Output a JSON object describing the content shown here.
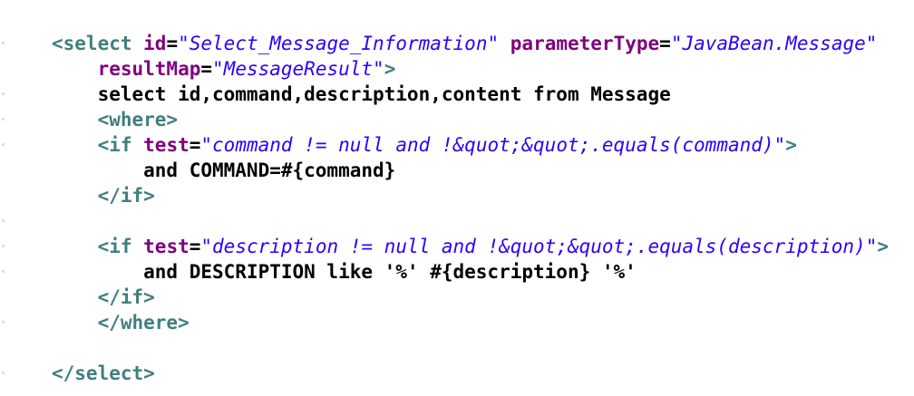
{
  "editor": {
    "colors": {
      "background": "#ffffff",
      "tag": "#3f7f7f",
      "attribute": "#7f007f",
      "value": "#2a00ff",
      "text": "#000000"
    },
    "lines": [
      [
        {
          "kind": "tag",
          "text": "<select "
        },
        {
          "kind": "attr",
          "text": "id"
        },
        {
          "kind": "txt",
          "text": "="
        },
        {
          "kind": "val",
          "text": "\"Select_Message_Information\""
        },
        {
          "kind": "txt",
          "text": " "
        },
        {
          "kind": "attr",
          "text": "parameterType"
        },
        {
          "kind": "txt",
          "text": "="
        },
        {
          "kind": "val",
          "text": "\"JavaBean.Message\""
        }
      ],
      [
        {
          "kind": "txt",
          "text": "    "
        },
        {
          "kind": "attr",
          "text": "resultMap"
        },
        {
          "kind": "txt",
          "text": "="
        },
        {
          "kind": "val",
          "text": "\"MessageResult\""
        },
        {
          "kind": "tag",
          "text": ">"
        }
      ],
      [
        {
          "kind": "txt",
          "text": "    select id,command,description,content from Message"
        }
      ],
      [
        {
          "kind": "txt",
          "text": "    "
        },
        {
          "kind": "tag",
          "text": "<where>"
        }
      ],
      [
        {
          "kind": "txt",
          "text": "    "
        },
        {
          "kind": "tag",
          "text": "<if "
        },
        {
          "kind": "attr",
          "text": "test"
        },
        {
          "kind": "txt",
          "text": "="
        },
        {
          "kind": "val",
          "text": "\"command != null and !&quot;&quot;.equals(command)\""
        },
        {
          "kind": "tag",
          "text": ">"
        }
      ],
      [
        {
          "kind": "txt",
          "text": "        and COMMAND=#{command}"
        }
      ],
      [
        {
          "kind": "txt",
          "text": "    "
        },
        {
          "kind": "tag",
          "text": "</if>"
        }
      ],
      [
        {
          "kind": "txt",
          "text": ""
        }
      ],
      [
        {
          "kind": "txt",
          "text": "    "
        },
        {
          "kind": "tag",
          "text": "<if "
        },
        {
          "kind": "attr",
          "text": "test"
        },
        {
          "kind": "txt",
          "text": "="
        },
        {
          "kind": "val",
          "text": "\"description != null and !&quot;&quot;.equals(description)\""
        },
        {
          "kind": "tag",
          "text": ">"
        }
      ],
      [
        {
          "kind": "txt",
          "text": "        and DESCRIPTION like '%' #{description} '%'"
        }
      ],
      [
        {
          "kind": "txt",
          "text": "    "
        },
        {
          "kind": "tag",
          "text": "</if>"
        }
      ],
      [
        {
          "kind": "txt",
          "text": "    "
        },
        {
          "kind": "tag",
          "text": "</where>"
        }
      ],
      [
        {
          "kind": "txt",
          "text": ""
        }
      ],
      [
        {
          "kind": "tag",
          "text": "</select>"
        }
      ]
    ]
  }
}
